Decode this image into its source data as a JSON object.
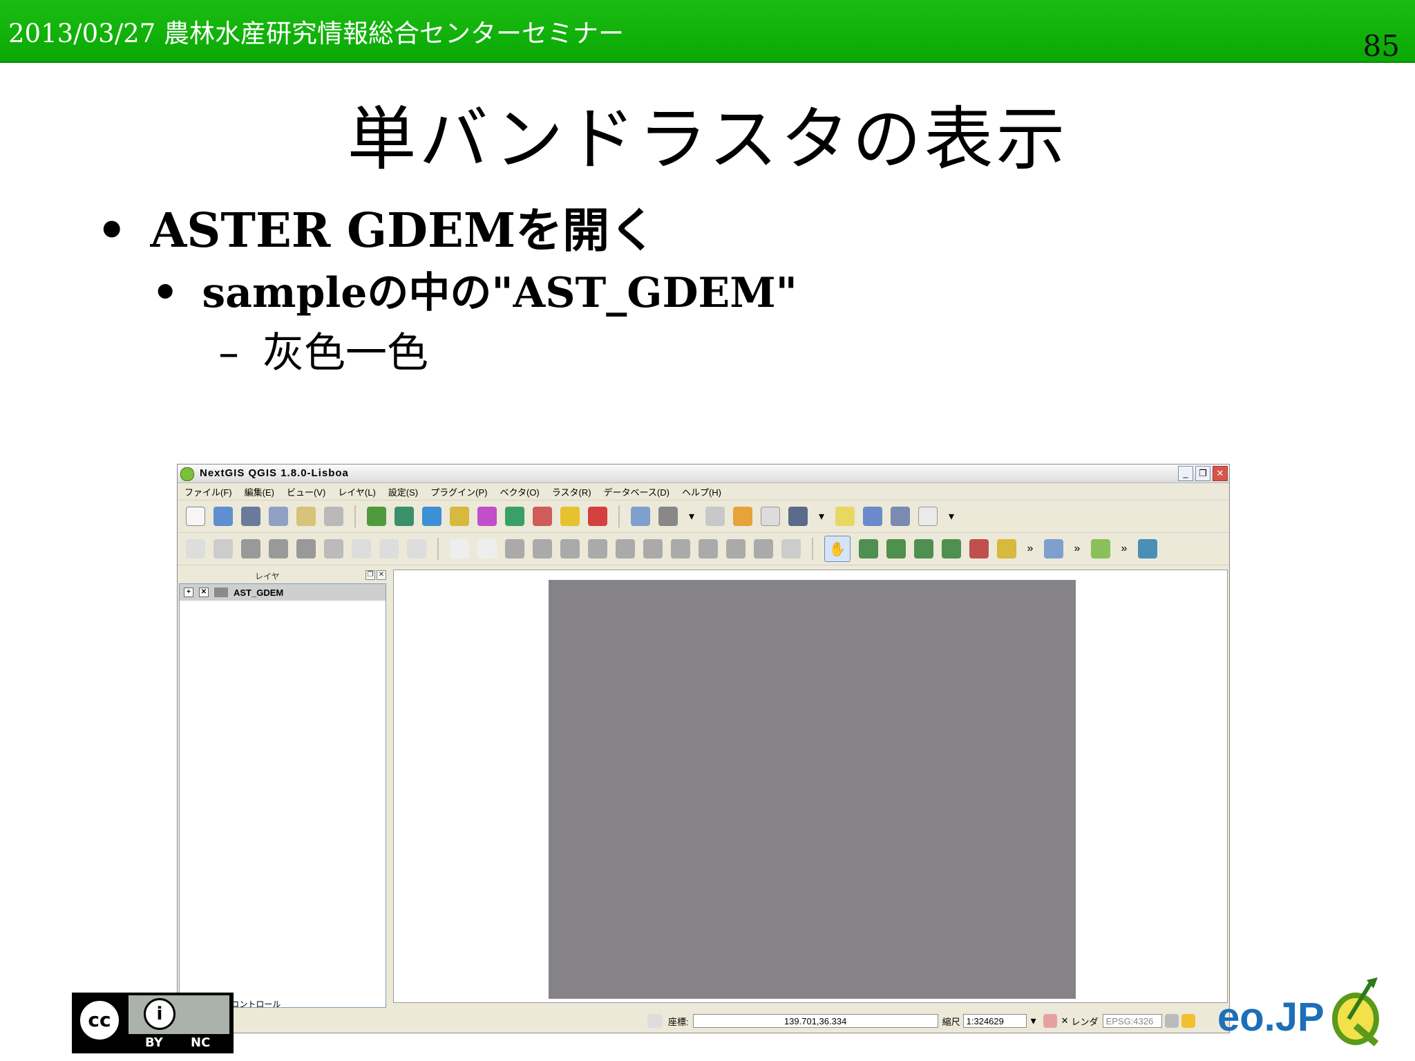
{
  "slide": {
    "date_text": "2013/03/27 農林水産研究情報総合センターセミナー",
    "page_number": "85",
    "title": "単バンドラスタの表示",
    "bullets": [
      {
        "text": "ASTER GDEMを開く"
      },
      {
        "text": "sampleの中の\"AST_GDEM\""
      },
      {
        "text": "灰色一色"
      }
    ]
  },
  "qgis": {
    "window_title": "NextGIS QGIS 1.8.0-Lisboa",
    "menu": [
      "ファイル(F)",
      "編集(E)",
      "ビュー(V)",
      "レイヤ(L)",
      "設定(S)",
      "プラグイン(P)",
      "ベクタ(O)",
      "ラスタ(R)",
      "データベース(D)",
      "ヘルプ(H)"
    ],
    "layers_panel": {
      "title": "レイヤ",
      "layer": "AST_GDEM",
      "draw_order_label": "描画順序のコントロール"
    },
    "statusbar": {
      "coord_label": "座標:",
      "coord_value": "139.701,36.334",
      "scale_label": "縮尺",
      "scale_value": "1:324629",
      "render_label": "レンダ",
      "epsg": "EPSG:4326"
    },
    "colors": {
      "raster_gray": "#858387",
      "header_green": "#10b20a"
    }
  },
  "footer": {
    "cc_by": "BY",
    "cc_nc": "NC",
    "osgeo_partial": "eo.JP"
  }
}
